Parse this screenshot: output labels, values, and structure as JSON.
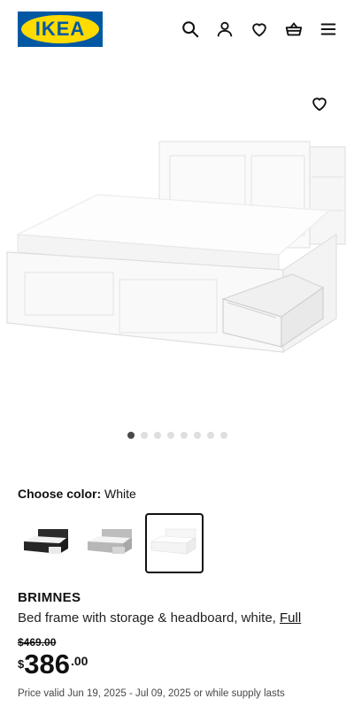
{
  "brand": {
    "logo_text": "IKEA",
    "colors": {
      "blue": "#0058a3",
      "yellow": "#ffdb00"
    }
  },
  "header": {
    "icons": [
      "search-icon",
      "user-icon",
      "heart-icon",
      "shopping-basket-icon",
      "hamburger-menu-icon"
    ]
  },
  "gallery": {
    "dot_count": 8,
    "active_index": 0,
    "favorite_icon": "heart-icon"
  },
  "color_picker": {
    "label": "Choose color:",
    "selected_value": "White",
    "options": [
      {
        "color": "black"
      },
      {
        "color": "gray"
      },
      {
        "color": "white",
        "selected": true
      }
    ]
  },
  "product": {
    "name": "BRIMNES",
    "description": "Bed frame with storage & headboard, white,",
    "size_link": "Full",
    "old_price": "$469.00",
    "price": {
      "currency": "$",
      "integer": "386",
      "decimal": ".00"
    },
    "validity": "Price valid Jun 19, 2025 - Jul 09, 2025 or while supply lasts"
  }
}
